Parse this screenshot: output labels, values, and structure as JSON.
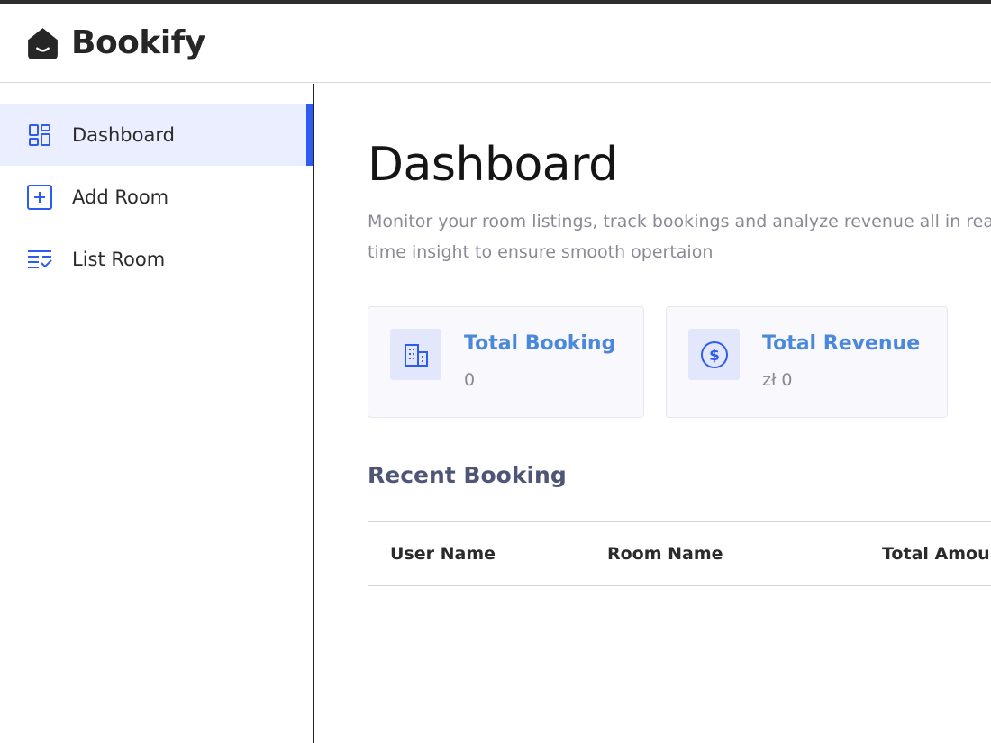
{
  "app": {
    "brand": "Bookify",
    "colors": {
      "accent": "#2f5cf0",
      "card_title": "#4a88dc",
      "active_bg": "#ebeefe"
    }
  },
  "sidebar": {
    "items": [
      {
        "label": "Dashboard",
        "icon": "dashboard-grid-icon",
        "active": true
      },
      {
        "label": "Add Room",
        "icon": "add-square-icon",
        "active": false
      },
      {
        "label": "List Room",
        "icon": "list-check-icon",
        "active": false
      }
    ]
  },
  "main": {
    "title": "Dashboard",
    "subtitle": "Monitor your room listings, track bookings and analyze revenue all in real-time insight to ensure smooth opertaion",
    "cards": [
      {
        "title": "Total Booking",
        "value": "0",
        "icon": "building-icon"
      },
      {
        "title": "Total Revenue",
        "value": "zł 0",
        "icon": "dollar-circle-icon"
      }
    ],
    "recent": {
      "title": "Recent Booking",
      "columns": [
        "User Name",
        "Room Name",
        "Total Amount"
      ]
    }
  }
}
